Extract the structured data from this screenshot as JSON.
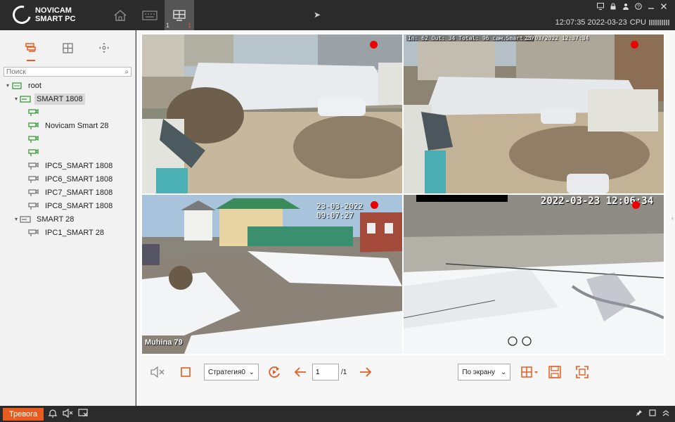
{
  "app": {
    "logo_line1": "NOVICAM",
    "logo_line2": "SMART PC"
  },
  "header": {
    "nav": [
      {
        "name": "home",
        "icon": "home-icon"
      },
      {
        "name": "keyboard",
        "icon": "keyboard-icon"
      },
      {
        "name": "layout",
        "icon": "layout-icon",
        "badge_left": "1",
        "badge_right": "1",
        "active": true
      }
    ],
    "clock": "12:07:35 2022-03-23",
    "cpu_label": "CPU",
    "win_icons": [
      "monitor-icon",
      "lock-icon",
      "user-icon",
      "help-icon",
      "minimize-icon",
      "close-icon"
    ]
  },
  "sidebar": {
    "tabs": [
      "device-list-icon",
      "grid-icon",
      "ptz-icon"
    ],
    "search_placeholder": "Поиск",
    "tree": [
      {
        "level": 0,
        "caret": "▾",
        "icon": "root",
        "label": "root"
      },
      {
        "level": 1,
        "caret": "▾",
        "icon": "nvr-green",
        "label": "SMART 1808",
        "selected": true
      },
      {
        "level": 2,
        "caret": "",
        "icon": "cam-green",
        "label": ""
      },
      {
        "level": 2,
        "caret": "",
        "icon": "cam-green",
        "label": "Novicam Smart 28"
      },
      {
        "level": 2,
        "caret": "",
        "icon": "cam-green",
        "label": ""
      },
      {
        "level": 2,
        "caret": "",
        "icon": "cam-green",
        "label": ""
      },
      {
        "level": 2,
        "caret": "",
        "icon": "cam-gray",
        "label": "IPC5_SMART 1808"
      },
      {
        "level": 2,
        "caret": "",
        "icon": "cam-gray",
        "label": "IPC6_SMART 1808"
      },
      {
        "level": 2,
        "caret": "",
        "icon": "cam-gray",
        "label": "IPC7_SMART 1808"
      },
      {
        "level": 2,
        "caret": "",
        "icon": "cam-gray",
        "label": "IPC8_SMART 1808"
      },
      {
        "level": 1,
        "caret": "▾",
        "icon": "nvr-gray",
        "label": "SMART 28"
      },
      {
        "level": 2,
        "caret": "",
        "icon": "cam-gray",
        "label": "IPC1_SMART 28"
      }
    ]
  },
  "tiles": [
    {
      "osd": ""
    },
    {
      "osd": "In: 62  Out: 34  Total: 96  сам.Smart 28",
      "time": "23/03/2022 12:37:34"
    },
    {
      "osd": "23-03-2022 09:07:27",
      "label": "Muhina 79"
    },
    {
      "osd": "2022-03-23 12:06:34"
    }
  ],
  "toolbar": {
    "strategy": "Стратегия0",
    "page": "1",
    "page_total": "/1",
    "fit": "По экрану"
  },
  "statusbar": {
    "alarm": "Тревога"
  },
  "colors": {
    "accent": "#e85c20",
    "green": "#3a9a3a",
    "dark": "#2b2b2b"
  }
}
